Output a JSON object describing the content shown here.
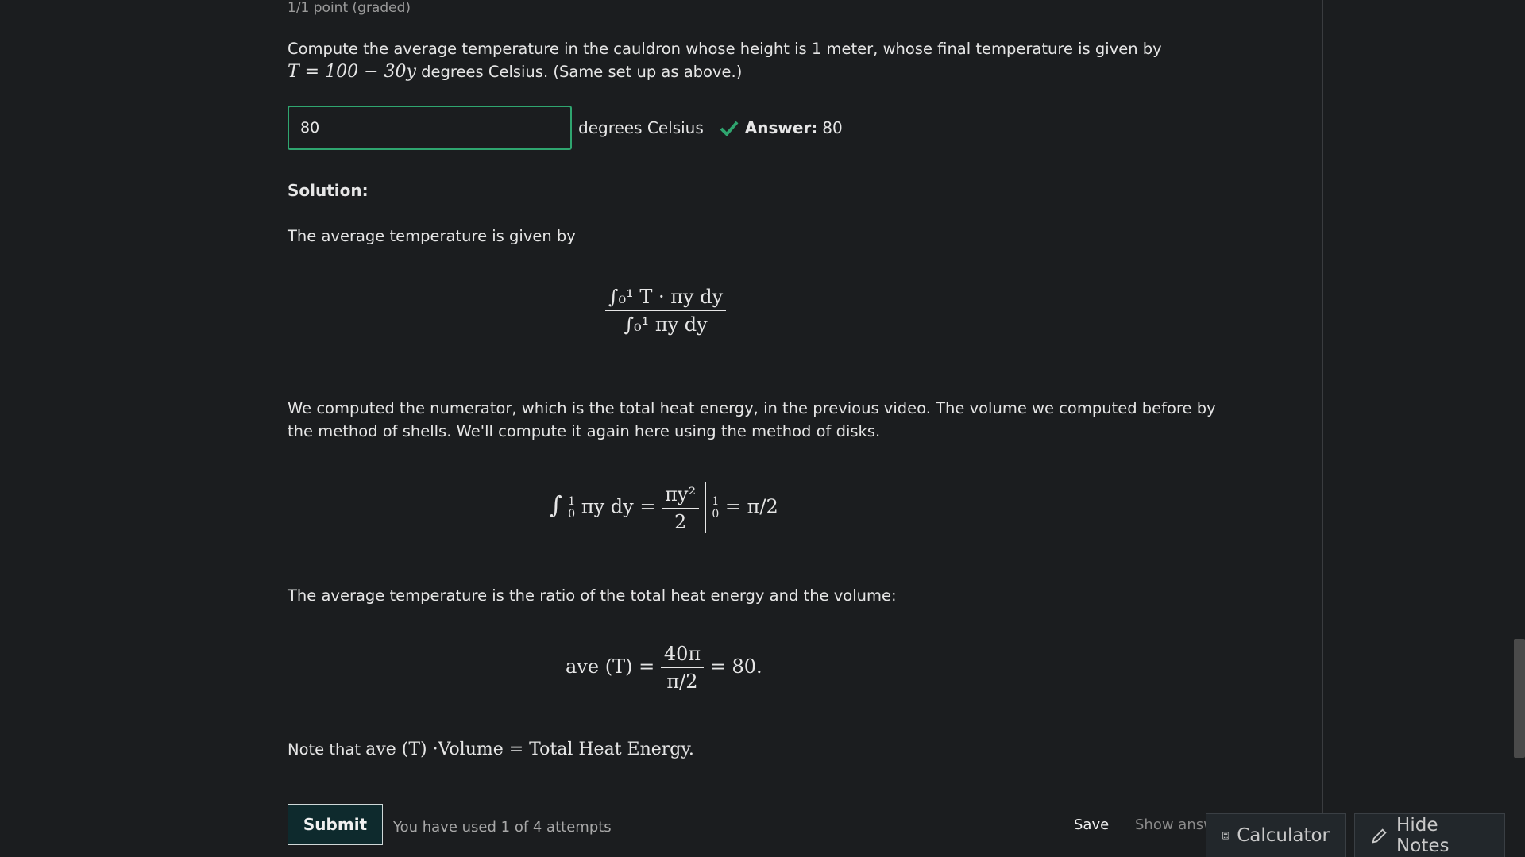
{
  "grade_status": "1/1 point (graded)",
  "question": {
    "text_1": "Compute the average temperature in the cauldron whose height is 1 meter, whose final temperature is given by",
    "formula": "T = 100 − 30y",
    "text_2": " degrees Celsius. (Same set up as above.)"
  },
  "answer": {
    "input_value": "80",
    "unit": "degrees Celsius",
    "label": "Answer:",
    "value": "80",
    "status": "correct",
    "status_color": "#2fa56f"
  },
  "solution": {
    "title": "Solution:",
    "p1": "The average temperature is given by",
    "eq1": {
      "num": "∫₀¹ T · πy dy",
      "den": "∫₀¹ πy dy"
    },
    "p2": "We computed the numerator, which is the total heat energy, in the previous video. The volume we computed before by the method of shells. We'll compute it again here using the method of disks.",
    "eq2": {
      "integrand": "πy dy =",
      "frac_num": "πy²",
      "frac_den": "2",
      "upper": "1",
      "lower": "0",
      "result": "= π/2"
    },
    "p3": "The average temperature is the ratio of the total heat energy and the volume:",
    "eq3": {
      "lhs": "ave (T) =",
      "frac_num": "40π",
      "frac_den": "π/2",
      "result": "= 80."
    },
    "note_prefix": "Note that ",
    "note_math": "ave (T) ·Volume = Total Heat Energy."
  },
  "actions": {
    "submit": "Submit",
    "attempts": "You have used 1 of 4 attempts",
    "save": "Save",
    "show_answer": "Show answer"
  },
  "tools": {
    "calculator": "Calculator",
    "hide_notes": "Hide Notes"
  }
}
